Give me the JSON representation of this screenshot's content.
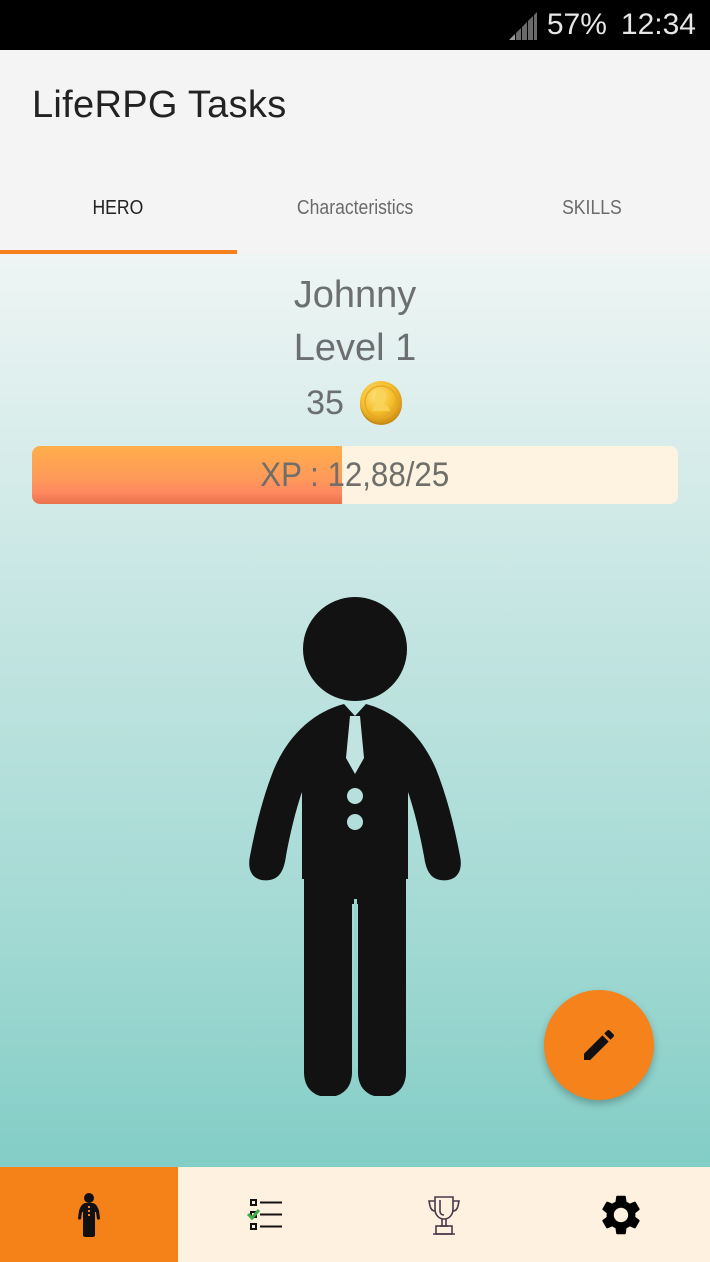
{
  "status_bar": {
    "battery": "57%",
    "time": "12:34",
    "icons": [
      "signal-icon"
    ]
  },
  "app_bar": {
    "title": "LifeRPG Tasks"
  },
  "tabs": [
    {
      "label": "HERO",
      "active": true
    },
    {
      "label": "Characteristics",
      "active": false
    },
    {
      "label": "SKILLS",
      "active": false
    }
  ],
  "hero": {
    "name": "Johnny",
    "level": "Level 1",
    "gold": "35",
    "gold_icon": "gold-coin-icon",
    "xp": {
      "label": "XP : 12,88/25",
      "current": 12.88,
      "max": 25,
      "fill_fraction": 0.48
    },
    "avatar_icon": "hero-figure-icon"
  },
  "fab": {
    "icon": "pencil-icon",
    "action": "edit"
  },
  "bottom_nav": [
    {
      "icon": "hero-icon",
      "active": true
    },
    {
      "icon": "tasks-checklist-icon",
      "active": false
    },
    {
      "icon": "trophy-icon",
      "active": false
    },
    {
      "icon": "settings-gear-icon",
      "active": false
    }
  ],
  "colors": {
    "accent": "#f5821f",
    "xp_fill_top": "#ffae4a",
    "xp_fill_bottom": "#e8724a",
    "xp_track": "#fef2e1",
    "nav_background": "#fef1e0",
    "content_gradient_top": "#eef5f4",
    "content_gradient_bottom": "#82cdc6",
    "checkmark": "#3fae4a"
  }
}
